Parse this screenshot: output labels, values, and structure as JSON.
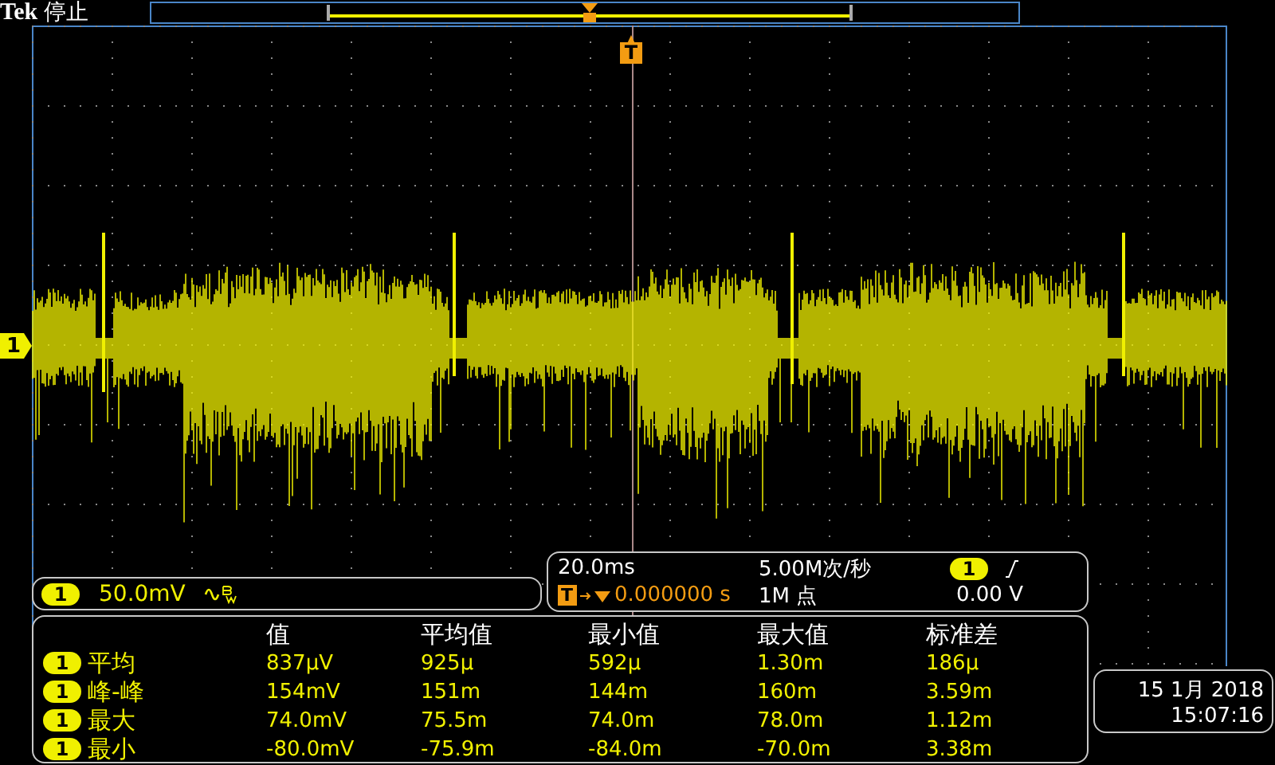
{
  "brand": "Tek",
  "run_state": "停止",
  "trigger_marker": "T",
  "channel_marker": "1",
  "vertical": {
    "channel": "1",
    "scale": "50.0mV",
    "bandwidth_limit": true
  },
  "horizontal": {
    "scale": "20.0ms",
    "trigger_label": "T",
    "trigger_position": "0.000000 s",
    "sample_rate": "5.00M次/秒",
    "record_length": "1M 点",
    "trigger_channel": "1",
    "trigger_level": "0.00 V"
  },
  "measurements": {
    "columns": [
      "值",
      "平均值",
      "最小值",
      "最大值",
      "标准差"
    ],
    "rows": [
      {
        "channel": "1",
        "name": "平均",
        "values": [
          "837µV",
          "925µ",
          "592µ",
          "1.30m",
          "186µ"
        ]
      },
      {
        "channel": "1",
        "name": "峰-峰",
        "values": [
          "154mV",
          "151m",
          "144m",
          "160m",
          "3.59m"
        ]
      },
      {
        "channel": "1",
        "name": "最大",
        "values": [
          "74.0mV",
          "75.5m",
          "74.0m",
          "78.0m",
          "1.12m"
        ]
      },
      {
        "channel": "1",
        "name": "最小",
        "values": [
          "-80.0mV",
          "-75.9m",
          "-84.0m",
          "-70.0m",
          "3.38m"
        ]
      }
    ]
  },
  "datetime": {
    "date": "15 1月 2018",
    "time": "15:07:16"
  }
}
